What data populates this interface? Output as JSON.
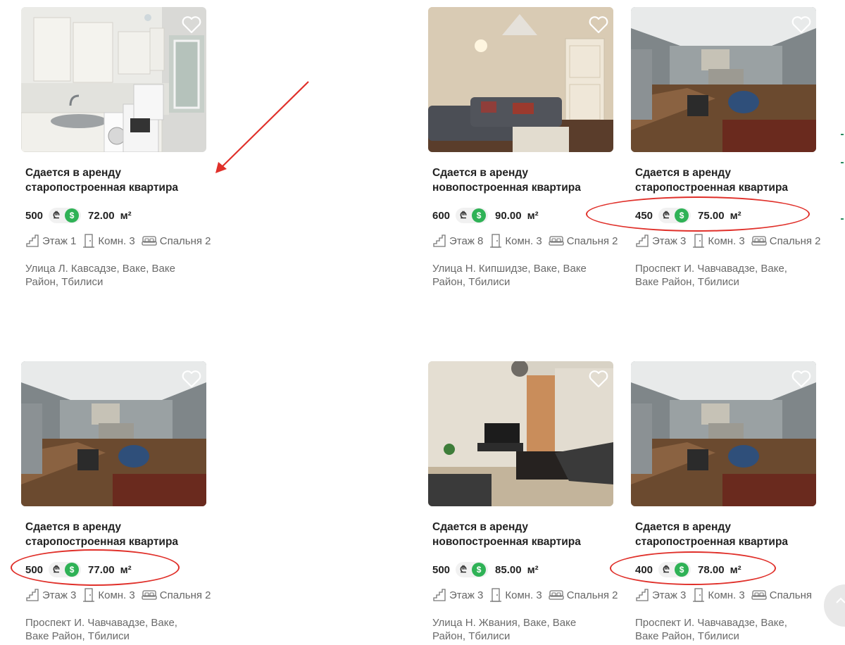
{
  "colors": {
    "accent": "#2fb256",
    "annotation": "#e0302a"
  },
  "listings": [
    {
      "title_line1": "Сдается в аренду",
      "title_line2": "старопостроенная квартира",
      "price": "500",
      "area": "72.00",
      "area_unit": "м²",
      "floor": "Этаж 1",
      "rooms": "Комн. 3",
      "bedrooms": "Спальня 2",
      "addr_line1": "Улица Л. Кавсадзе, Ваке, Ваке",
      "addr_line2": "Район, Тбилиси"
    },
    {
      "title_line1": "Сдается в аренду",
      "title_line2": "новопостроенная квартира",
      "price": "600",
      "area": "90.00",
      "area_unit": "м²",
      "floor": "Этаж 8",
      "rooms": "Комн. 3",
      "bedrooms": "Спальня 2",
      "addr_line1": "Улица Н. Кипшидзе, Ваке, Ваке",
      "addr_line2": "Район, Тбилиси"
    },
    {
      "title_line1": "Сдается в аренду",
      "title_line2": "старопостроенная квартира",
      "price": "450",
      "area": "75.00",
      "area_unit": "м²",
      "floor": "Этаж 3",
      "rooms": "Комн. 3",
      "bedrooms": "Спальня 2",
      "addr_line1": "Проспект И. Чавчавадзе, Ваке,",
      "addr_line2": "Ваке Район, Тбилиси"
    },
    {
      "title_line1": "Сдается в аренду",
      "title_line2": "старопостроенная квартира",
      "price": "500",
      "area": "77.00",
      "area_unit": "м²",
      "floor": "Этаж 3",
      "rooms": "Комн. 3",
      "bedrooms": "Спальня 2",
      "addr_line1": "Проспект И. Чавчавадзе, Ваке,",
      "addr_line2": "Ваке Район, Тбилиси"
    },
    {
      "title_line1": "Сдается в аренду",
      "title_line2": "новопостроенная квартира",
      "price": "500",
      "area": "85.00",
      "area_unit": "м²",
      "floor": "Этаж 3",
      "rooms": "Комн. 3",
      "bedrooms": "Спальня 2",
      "addr_line1": "Улица Н. Жвания, Ваке, Ваке",
      "addr_line2": "Район, Тбилиси"
    },
    {
      "title_line1": "Сдается в аренду",
      "title_line2": "старопостроенная квартира",
      "price": "400",
      "area": "78.00",
      "area_unit": "м²",
      "floor": "Этаж 3",
      "rooms": "Комн. 3",
      "bedrooms": "Спальня",
      "addr_line1": "Проспект И. Чавчавадзе, Ваке,",
      "addr_line2": "Ваке Район, Тбилиси"
    }
  ],
  "currency": {
    "gel_symbol": "₾",
    "usd_symbol": "$"
  },
  "icons": {
    "favorite": "heart-outline-icon",
    "floor": "stairs-icon",
    "rooms": "door-icon",
    "bedrooms": "bed-icon",
    "scroll_top": "chevron-up-icon"
  }
}
